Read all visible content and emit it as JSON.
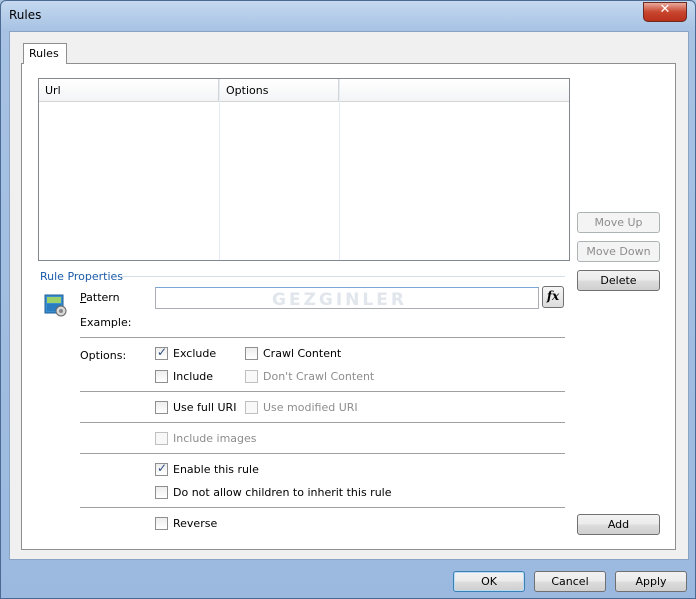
{
  "window": {
    "title": "Rules",
    "close_label": "✕"
  },
  "tabs": [
    {
      "label": "Rules"
    }
  ],
  "list": {
    "columns": [
      {
        "label": "Url"
      },
      {
        "label": "Options"
      },
      {
        "label": ""
      }
    ],
    "rows": []
  },
  "side_buttons": {
    "move_up": "Move  Up",
    "move_down": "Move Down",
    "delete": "Delete",
    "add": "Add"
  },
  "rule_properties": {
    "group_label": "Rule Properties",
    "pattern_label": "Pattern",
    "pattern_value": "",
    "example_label": "Example:",
    "fx_label": "fx",
    "watermark": "GEZGINLER",
    "options_label": "Options:"
  },
  "options": {
    "exclude": {
      "label": "Exclude",
      "checked": true,
      "enabled": true
    },
    "crawl_content": {
      "label": "Crawl Content",
      "checked": false,
      "enabled": true
    },
    "include": {
      "label": "Include",
      "checked": false,
      "enabled": true
    },
    "dont_crawl_content": {
      "label": "Don't Crawl Content",
      "checked": false,
      "enabled": false
    },
    "use_full_uri": {
      "label": "Use full URI",
      "checked": false,
      "enabled": true
    },
    "use_modified_uri": {
      "label": "Use modified URI",
      "checked": false,
      "enabled": false
    },
    "include_images": {
      "label": "Include images",
      "checked": false,
      "enabled": false
    },
    "enable_rule": {
      "label": "Enable this rule",
      "checked": true,
      "enabled": true
    },
    "no_inherit": {
      "label": "Do not allow children to inherit this rule",
      "checked": false,
      "enabled": true
    },
    "reverse": {
      "label": "Reverse",
      "checked": false,
      "enabled": true
    }
  },
  "footer": {
    "ok": "OK",
    "cancel": "Cancel",
    "apply": "Apply"
  }
}
